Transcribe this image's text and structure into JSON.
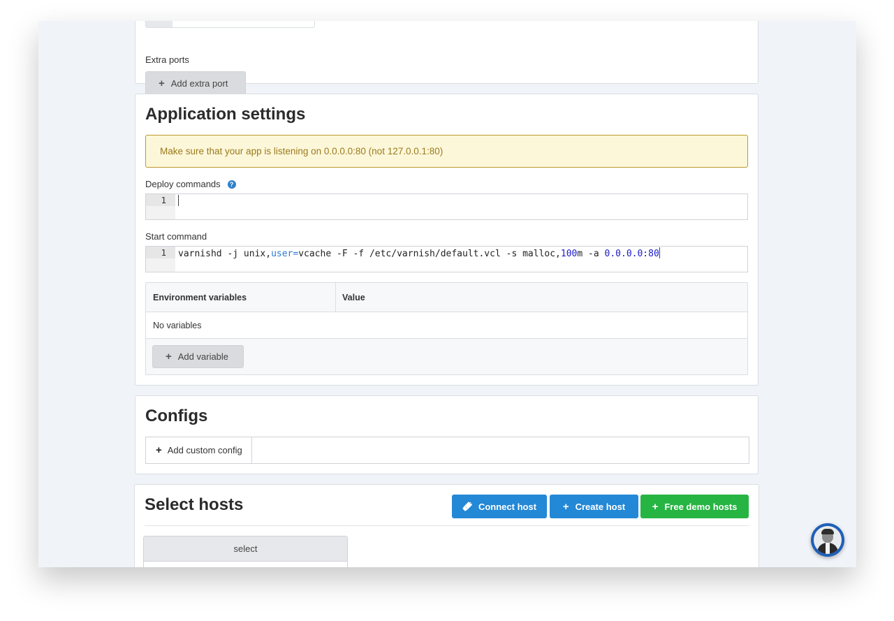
{
  "ports": {
    "cut_value": "…",
    "extra_ports_label": "Extra ports",
    "add_extra_port_label": "Add extra port"
  },
  "app_settings": {
    "title": "Application settings",
    "warning": "Make sure that your app is listening on 0.0.0.0:80 (not 127.0.0.1:80)",
    "deploy_label": "Deploy commands",
    "deploy_help_icon": "?",
    "deploy_line_number": "1",
    "deploy_code": "",
    "start_label": "Start command",
    "start_line_number": "1",
    "start_code": {
      "p1": "varnishd -j unix,",
      "p2": "user=",
      "p3": "vcache -F -f /etc/varnish/default.vcl -s malloc,",
      "p4": "100",
      "p5": "m -a ",
      "p6": "0.0.0.0:80"
    },
    "env_table": {
      "col_name": "Environment variables",
      "col_value": "Value",
      "empty_text": "No variables",
      "add_variable_label": "Add variable"
    }
  },
  "configs": {
    "title": "Configs",
    "add_config_label": "Add custom config"
  },
  "hosts": {
    "title": "Select hosts",
    "connect_label": "Connect host",
    "create_label": "Create host",
    "demo_label": "Free demo hosts",
    "select_header": "select"
  },
  "colors": {
    "primary_blue": "#2388d6",
    "success_green": "#26b443",
    "warning_bg": "#fdf7da",
    "warning_text": "#9a7a1c"
  },
  "icons": [
    "plus-icon",
    "help-icon",
    "plug-icon",
    "support-avatar"
  ]
}
